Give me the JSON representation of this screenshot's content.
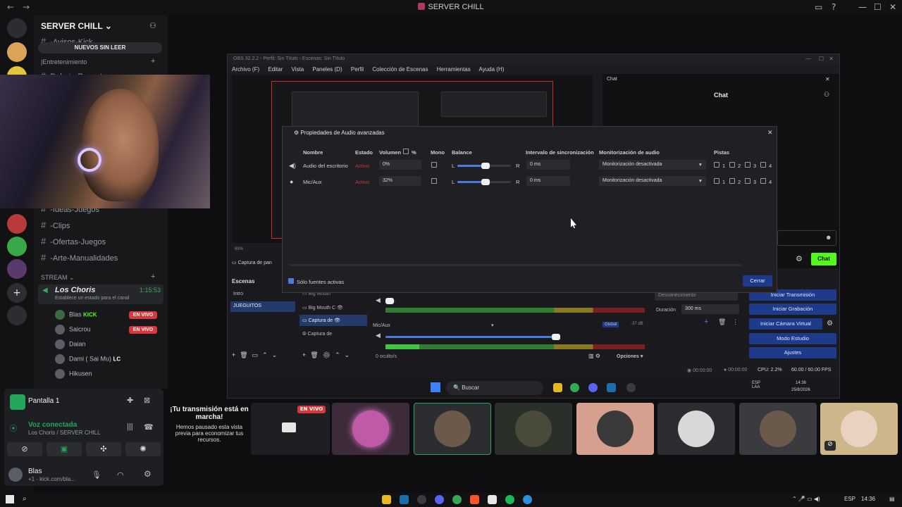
{
  "app": {
    "title": "SERVER CHILL"
  },
  "server": {
    "name": "SERVER CHILL",
    "banner": "NUEVOS SIN LEER",
    "channels_top": [
      "-Avisos-Kick",
      "Debate-Respetuoso"
    ],
    "category_entertainment": "|Entretenimiento",
    "channels": [
      "-Ideas-Juegos",
      "-Clips",
      "-Ofertas-Juegos",
      "-Arte-Manualidades"
    ],
    "category_stream": "STREAM",
    "voice_channel": {
      "name": "Los Choris",
      "timer": "1:15:53",
      "status_placeholder": "Establece un estado para el canal"
    },
    "voice_users": [
      {
        "name": "Blas",
        "badge": "KICK",
        "live": "EN VIVO"
      },
      {
        "name": "Saicrou",
        "badge": "",
        "live": "EN VIVO"
      },
      {
        "name": "Daian",
        "badge": "",
        "live": ""
      },
      {
        "name": "Dami ( Sai Mu)",
        "badge": "LC",
        "live": ""
      },
      {
        "name": "Hikusen",
        "badge": "",
        "live": ""
      }
    ]
  },
  "voice_panel": {
    "screen_label": "Pantalla 1",
    "connected": "Voz conectada",
    "location": "Los Choris / SERVER CHILL",
    "user_name": "Blas",
    "user_status": "+1 · kick.com/bla..."
  },
  "obs": {
    "title": "OBS 32.2.2 - Perfil: Sin Título - Escenas: Sin Título",
    "menu": [
      "Archivo (F)",
      "Editar",
      "Vista",
      "Paneles (D)",
      "Perfil",
      "Colección de Escenas",
      "Herramientas",
      "Ayuda (H)"
    ],
    "chat_dock_title": "Chat",
    "chat_heading": "Chat",
    "chat_button": "Chat",
    "capture_label": "Captura de pan",
    "zoom": "65%",
    "scenes_title": "Escenas",
    "scenes": [
      "Intro",
      "JUEGUITOS"
    ],
    "sources": [
      "Big Mouth",
      "Big Mouth C",
      "Captura de",
      "Captura de"
    ],
    "hidden_count": "0 oculto/s",
    "options": "Opciones",
    "mixer_track": "Mic/Aux",
    "mixer_global": "Global",
    "mixer_db": "-37 dB",
    "transition_name": "Desvanecimiento",
    "duration_label": "Duración",
    "duration_value": "300 ms",
    "controls": [
      "Iniciar Transmisión",
      "Iniciar Grabación",
      "Iniciar Cámara Virtual",
      "Modo Estudio",
      "Ajustes"
    ],
    "status": {
      "stream_time": "00:00:00",
      "rec_time": "00:00:00",
      "cpu": "CPU: 2.2%",
      "fps": "60.00 / 60.00 FPS"
    },
    "inner_taskbar": {
      "search": "Buscar",
      "lang": "ESP LAA",
      "time": "14:36",
      "date": "25/8/2026"
    }
  },
  "dialog": {
    "title": "Propiedades de Audio avanzadas",
    "headers": [
      "Nombre",
      "Estado",
      "Volumen",
      "%",
      "Mono",
      "Balance",
      "Intervalo de sincronización",
      "Monitorización de audio",
      "Pistas"
    ],
    "rows": [
      {
        "name": "Audio del escritorio",
        "state": "Activo",
        "volume": "0%",
        "sync": "0 ms",
        "monitor": "Monitorización desactivada",
        "balance": 0.5
      },
      {
        "name": "Mic/Aux",
        "state": "Activo",
        "volume": "32%",
        "sync": "0 ms",
        "monitor": "Monitorización desactivada",
        "balance": 0.5
      }
    ],
    "balance_left": "L",
    "balance_right": "R",
    "tracks": [
      "1",
      "2",
      "3",
      "4"
    ],
    "only_active": "Sólo fuentes activas",
    "close": "Cerrar"
  },
  "stream_tiles": {
    "message_title": "¡Tu transmisión está en marcha!",
    "message_body": "Hemos pausado esta vista previa para economizar tus recursos.",
    "live": "EN VIVO"
  },
  "taskbar": {
    "lang": "ESP",
    "time": "14:36"
  }
}
